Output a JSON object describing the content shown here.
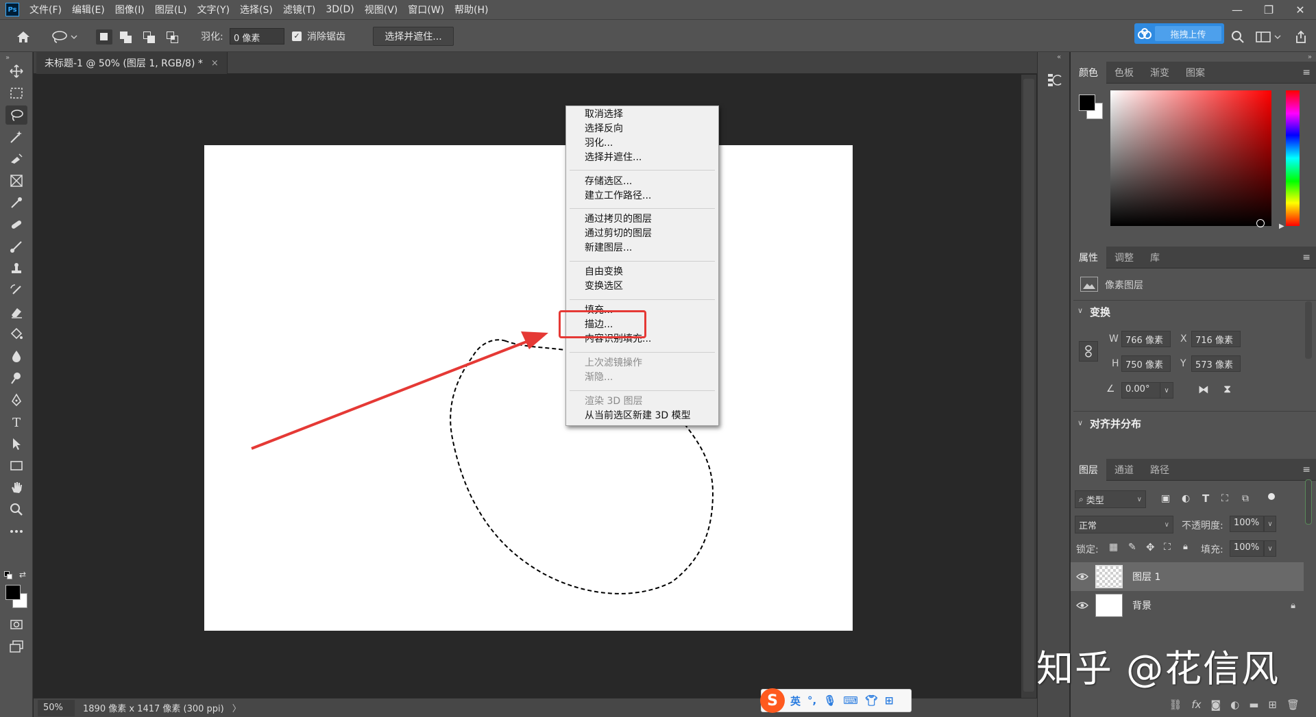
{
  "menubar": {
    "logo": "Ps",
    "items": [
      "文件(F)",
      "编辑(E)",
      "图像(I)",
      "图层(L)",
      "文字(Y)",
      "选择(S)",
      "滤镜(T)",
      "3D(D)",
      "视图(V)",
      "窗口(W)",
      "帮助(H)"
    ],
    "window_controls": [
      "—",
      "❐",
      "✕"
    ]
  },
  "options": {
    "feather_label": "羽化:",
    "feather_value": "0 像素",
    "antialias_label": "消除锯齿",
    "antialias_checked": true,
    "select_mask_button": "选择并遮住...",
    "upload_button": "拖拽上传"
  },
  "document": {
    "tab_title": "未标题-1 @ 50% (图层 1, RGB/8) *",
    "tab_close": "×",
    "zoom": "50%",
    "doc_size": "1890 像素 x 1417 像素 (300 ppi)",
    "status_arrow": "〉"
  },
  "context_menu": {
    "groups": [
      [
        "取消选择",
        "选择反向",
        "羽化...",
        "选择并遮住..."
      ],
      [
        "存储选区...",
        "建立工作路径..."
      ],
      [
        "通过拷贝的图层",
        "通过剪切的图层",
        "新建图层..."
      ],
      [
        "自由变换",
        "变换选区"
      ],
      [
        "填充...",
        "描边...",
        "内容识别填充..."
      ],
      [
        "上次滤镜操作",
        "渐隐..."
      ],
      [
        "渲染 3D 图层",
        "从当前选区新建 3D 模型"
      ]
    ],
    "disabled": [
      "上次滤镜操作",
      "渐隐...",
      "渲染 3D 图层"
    ]
  },
  "color_panel": {
    "tabs": [
      "颜色",
      "色板",
      "渐变",
      "图案"
    ],
    "foreground": "#000000",
    "background": "#ffffff"
  },
  "properties_panel": {
    "tabs": [
      "属性",
      "调整",
      "库"
    ],
    "layer_type": "像素图层",
    "transform_heading": "变换",
    "w_label": "W",
    "w_value": "766 像素",
    "x_label": "X",
    "x_value": "716 像素",
    "h_label": "H",
    "h_value": "750 像素",
    "y_label": "Y",
    "y_value": "573 像素",
    "angle_value": "0.00°",
    "align_heading": "对齐并分布"
  },
  "layers_panel": {
    "tabs": [
      "图层",
      "通道",
      "路径"
    ],
    "filter_label": "类型",
    "blend_mode": "正常",
    "opacity_label": "不透明度:",
    "opacity_value": "100%",
    "lock_label": "锁定:",
    "fill_label": "填充:",
    "fill_value": "100%",
    "layers": [
      {
        "name": "图层 1",
        "selected": true,
        "locked": false
      },
      {
        "name": "背景",
        "selected": false,
        "locked": true
      }
    ]
  },
  "watermark": "知乎 @花信风",
  "ime": {
    "logo": "S",
    "mode": "英"
  },
  "colors": {
    "accent_red": "#e53935",
    "upload_blue": "#2f8ae0"
  }
}
